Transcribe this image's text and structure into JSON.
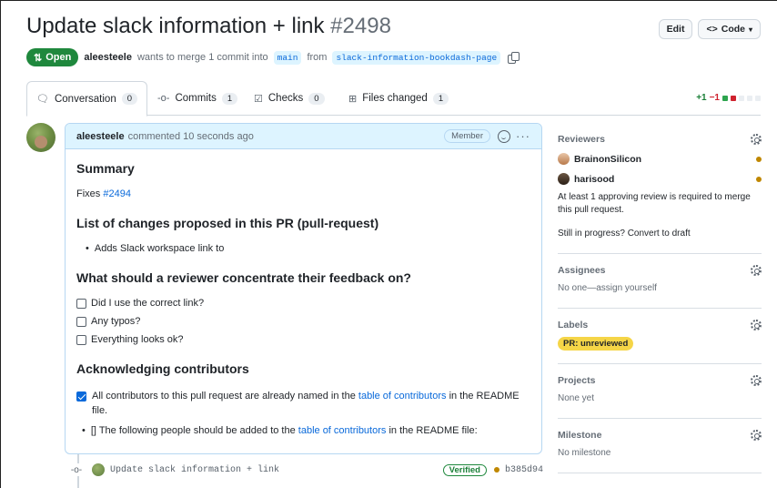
{
  "header": {
    "title": "Update slack information + link",
    "number": "#2498",
    "edit_label": "Edit",
    "code_label": "Code",
    "state": "Open",
    "author": "aleesteele",
    "merge_text_1": "wants to merge 1 commit into",
    "base_branch": "main",
    "merge_text_2": "from",
    "head_branch": "slack-information-bookdash-page"
  },
  "tabs": [
    {
      "label": "Conversation",
      "count": "0"
    },
    {
      "label": "Commits",
      "count": "1"
    },
    {
      "label": "Checks",
      "count": "0"
    },
    {
      "label": "Files changed",
      "count": "1"
    }
  ],
  "diffstat": {
    "additions": "+1",
    "deletions": "−1"
  },
  "comment": {
    "author": "aleesteele",
    "meta": "commented 10 seconds ago",
    "badge": "Member",
    "summary_heading": "Summary",
    "fixes_text": "Fixes",
    "fixes_link": "#2494",
    "changes_heading": "List of changes proposed in this PR (pull-request)",
    "changes_item": "Adds Slack workspace link to",
    "feedback_heading": "What should a reviewer concentrate their feedback on?",
    "checklist": [
      "Did I use the correct link?",
      "Any typos?",
      "Everything looks ok?"
    ],
    "ack_heading": "Acknowledging contributors",
    "ack_check_1": "All contributors to this pull request are already named in the",
    "ack_link": "table of contributors",
    "ack_check_2": "in the README file.",
    "ack_bullet_1": "[] The following people should be added to the",
    "ack_bullet_link": "table of contributors",
    "ack_bullet_2": "in the README file:"
  },
  "commit": {
    "message": "Update slack information + link",
    "verified": "Verified",
    "sha": "b385d94"
  },
  "sidebar": {
    "reviewers_title": "Reviewers",
    "reviewers": [
      "BrainonSilicon",
      "harisood"
    ],
    "review_note": "At least 1 approving review is required to merge this pull request.",
    "draft_note": "Still in progress? Convert to draft",
    "assignees_title": "Assignees",
    "assignees_text": "No one—assign yourself",
    "labels_title": "Labels",
    "label": "PR: unreviewed",
    "projects_title": "Projects",
    "projects_text": "None yet",
    "milestone_title": "Milestone",
    "milestone_text": "No milestone"
  }
}
